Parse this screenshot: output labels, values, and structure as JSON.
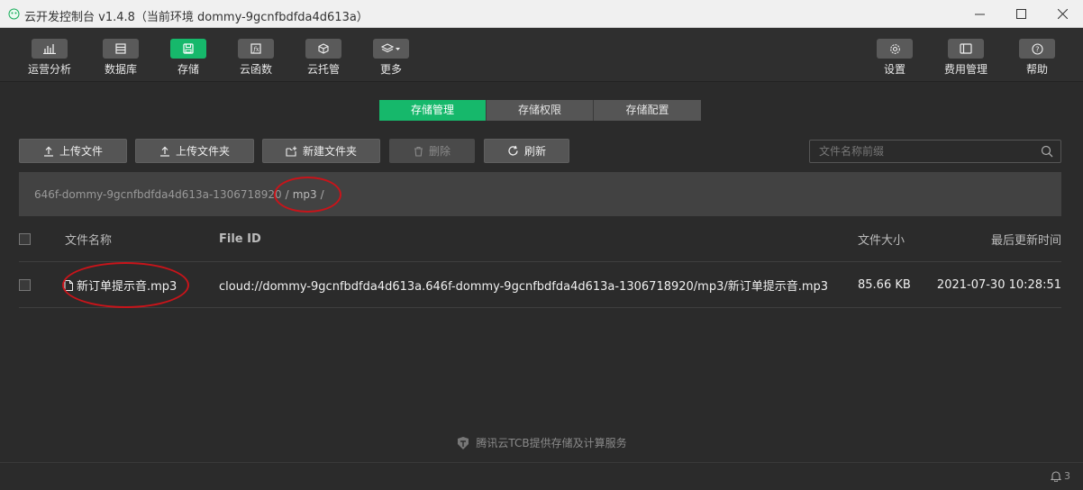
{
  "window": {
    "title": "云开发控制台 v1.4.8（当前环境 dommy-9gcnfbdfda4d613a）",
    "minimize_icon": "minimize-icon",
    "maximize_icon": "maximize-icon",
    "close_icon": "close-icon"
  },
  "toolbar": {
    "left": [
      {
        "label": "运营分析",
        "icon": "bar-chart-icon"
      },
      {
        "label": "数据库",
        "icon": "database-icon"
      },
      {
        "label": "存储",
        "icon": "save-icon",
        "active": true
      },
      {
        "label": "云函数",
        "icon": "function-icon"
      },
      {
        "label": "云托管",
        "icon": "cube-icon"
      },
      {
        "label": "更多",
        "icon": "layers-icon"
      }
    ],
    "right": [
      {
        "label": "设置",
        "icon": "gear-icon"
      },
      {
        "label": "费用管理",
        "icon": "billing-icon"
      },
      {
        "label": "帮助",
        "icon": "help-icon"
      }
    ]
  },
  "tabs": [
    {
      "label": "存储管理",
      "active": true
    },
    {
      "label": "存储权限"
    },
    {
      "label": "存储配置"
    }
  ],
  "actions": {
    "upload_file": "上传文件",
    "upload_folder": "上传文件夹",
    "new_folder": "新建文件夹",
    "delete": "删除",
    "refresh": "刷新"
  },
  "search": {
    "placeholder": "文件名称前缀"
  },
  "breadcrumb": {
    "root": "646f-dommy-9gcnfbdfda4d613a-1306718920",
    "sep": "/",
    "current": "mp3",
    "trail": "/"
  },
  "table": {
    "headers": {
      "name": "文件名称",
      "file_id": "File ID",
      "size": "文件大小",
      "updated": "最后更新时间"
    },
    "rows": [
      {
        "name": "新订单提示音.mp3",
        "file_id": "cloud://dommy-9gcnfbdfda4d613a.646f-dommy-9gcnfbdfda4d613a-1306718920/mp3/新订单提示音.mp3",
        "size": "85.66 KB",
        "updated": "2021-07-30 10:28:51"
      }
    ]
  },
  "footer": {
    "text": "腾讯云TCB提供存储及计算服务"
  },
  "status": {
    "notifications": "3"
  },
  "colors": {
    "accent": "#16b86b",
    "annotation": "#c8141a"
  }
}
